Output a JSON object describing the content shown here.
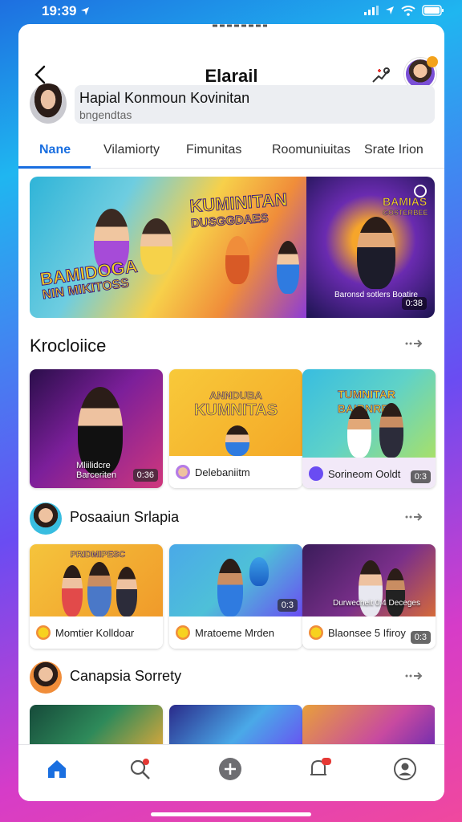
{
  "status": {
    "time": "19:39"
  },
  "header": {
    "title": "Elarail"
  },
  "profile": {
    "name": "Hapial Konmoun Kovinitan",
    "subtitle": "bngendtas"
  },
  "tabs": [
    {
      "label": "Nane",
      "active": true
    },
    {
      "label": "Vilamiorty"
    },
    {
      "label": "Fimunitas"
    },
    {
      "label": "Roomuniuitas"
    },
    {
      "label": "Srate Irion"
    }
  ],
  "hero": {
    "title_main": "KUMINITAN",
    "title_sub": "DUSGGDAES",
    "title_left": "BAMIDOGA",
    "title_left_2": "NIN MIKITOSS",
    "title_right": "BAMIAS",
    "title_right_2": "GOSTERBEE",
    "caption": "Baronsd sotlers Boatire",
    "badge": "0:38"
  },
  "sections": [
    {
      "title": "Krocloiice",
      "more": "→",
      "tiles": [
        {
          "label": "",
          "overlay": "Mliilidcre\nBarceriten",
          "badge": "0:36"
        },
        {
          "label": "Delebaniitm",
          "art_top": "ANNDUBA",
          "art": "KUMNITAS"
        },
        {
          "label": "Sorineom Ooldt",
          "art": "TUMNITAR\nBAIBNRFS",
          "badge": "0:3"
        }
      ]
    },
    {
      "title": "Posaaiun Srlapia",
      "more": "→",
      "tiles": [
        {
          "label": "Momtier Kolldoar",
          "art": "PRIDMIPESC"
        },
        {
          "label": "Mratoeme Mrden",
          "badge": "0:3"
        },
        {
          "label": "Blaonsee 5 Ifiroy",
          "overlay": "Durwecheit 0:4 Deceges",
          "badge": "0:3"
        }
      ]
    },
    {
      "title": "Canapsia Sorrety",
      "more": "→"
    }
  ],
  "nav": [
    {
      "name": "home",
      "active": true
    },
    {
      "name": "search"
    },
    {
      "name": "add"
    },
    {
      "name": "notifications"
    },
    {
      "name": "profile"
    }
  ],
  "colors": {
    "accent": "#1a6fe0",
    "notification": "#e53935"
  }
}
